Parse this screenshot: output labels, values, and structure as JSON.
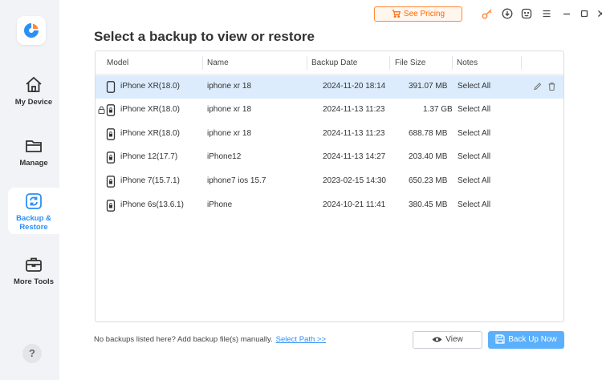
{
  "sidebar": {
    "items": [
      {
        "label": "My Device"
      },
      {
        "label": "Manage"
      },
      {
        "label": "Backup &\nRestore"
      },
      {
        "label": "More Tools"
      }
    ],
    "help_label": "?"
  },
  "titlebar": {
    "pricing_label": "See Pricing"
  },
  "page": {
    "title": "Select a backup to view or restore"
  },
  "table": {
    "columns": [
      "Model",
      "Name",
      "Backup Date",
      "File Size",
      "Notes"
    ],
    "rows": [
      {
        "model": "iPhone XR(18.0)",
        "name": "iphone xr 18",
        "date": "2024-11-20 18:14",
        "size": "391.07 MB",
        "notes": "Select All",
        "selected": true,
        "locked": false
      },
      {
        "model": "iPhone XR(18.0)",
        "name": "iphone xr 18",
        "date": "2024-11-13 11:23",
        "size": "1.37 GB",
        "notes": "Select All",
        "selected": false,
        "locked": true
      },
      {
        "model": "iPhone XR(18.0)",
        "name": "iphone xr 18",
        "date": "2024-11-13 11:23",
        "size": "688.78 MB",
        "notes": "Select All",
        "selected": false,
        "locked": false
      },
      {
        "model": "iPhone 12(17.7)",
        "name": "iPhone12",
        "date": "2024-11-13 14:27",
        "size": "203.40 MB",
        "notes": "Select All",
        "selected": false,
        "locked": false
      },
      {
        "model": "iPhone 7(15.7.1)",
        "name": "iphone7 ios 15.7",
        "date": "2023-02-15 14:30",
        "size": "650.23 MB",
        "notes": "Select All",
        "selected": false,
        "locked": false
      },
      {
        "model": "iPhone 6s(13.6.1)",
        "name": "iPhone",
        "date": "2024-10-21 11:41",
        "size": "380.45 MB",
        "notes": "Select All",
        "selected": false,
        "locked": false
      }
    ]
  },
  "footer": {
    "text": "No backups listed here? Add backup file(s) manually.",
    "link": "Select Path >>",
    "view_label": "View",
    "backup_label": "Back Up Now"
  },
  "colors": {
    "accent": "#2c8ef7",
    "selected_row": "#dcecfd",
    "pricing": "#ff6a00",
    "primary_button": "#5ab0fc"
  }
}
